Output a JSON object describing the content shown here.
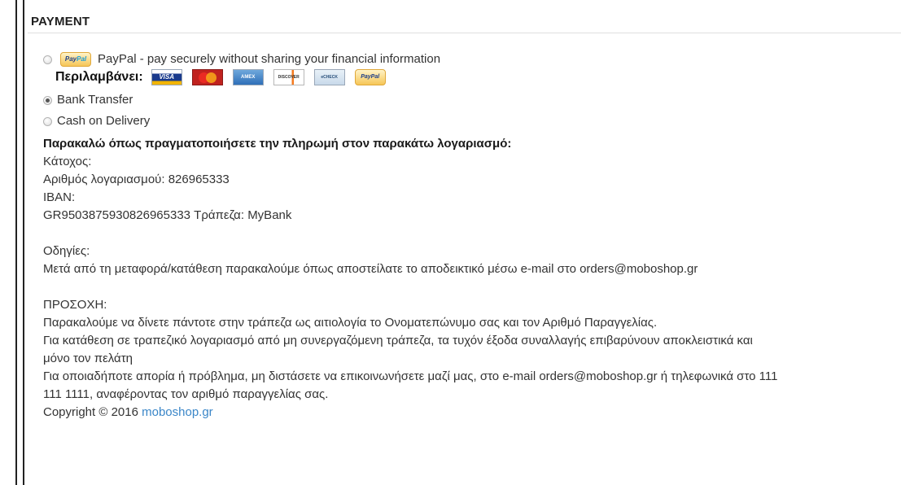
{
  "section": {
    "title": "PAYMENT"
  },
  "payment_methods": [
    {
      "label": "PayPal - pay securely without sharing your financial information",
      "selected": false,
      "logo_text": "PayPal"
    },
    {
      "label": "Bank Transfer",
      "selected": true
    },
    {
      "label": "Cash on Delivery",
      "selected": false
    }
  ],
  "cards": {
    "label": "Περιλαμβάνει:",
    "items": [
      {
        "name": "visa",
        "text": "VISA"
      },
      {
        "name": "mastercard",
        "text": ""
      },
      {
        "name": "amex",
        "text": "AMEX"
      },
      {
        "name": "discover",
        "text": "DISCOVER"
      },
      {
        "name": "echeck",
        "text": "eCHECK"
      },
      {
        "name": "paypal",
        "text": "PayPal"
      }
    ]
  },
  "bank_details": {
    "heading": "Παρακαλώ όπως πραγματοποιήσετε την πληρωμή στον παρακάτω λογαριασμό:",
    "holder": "Κάτοχος:",
    "account": "Αριθμός λογαριασμού: 826965333",
    "iban_label": "IBAN:",
    "iban_bank": "GR9503875930826965333 Τράπεζα: MyBank"
  },
  "instructions": {
    "label": "Οδηγίες:",
    "text": "Μετά από τη μεταφορά/κατάθεση παρακαλούμε όπως αποστείλατε το αποδεικτικό μέσω e-mail στο orders@moboshop.gr"
  },
  "notice": {
    "label": "ΠΡΟΣΟΧΗ:",
    "line1": "Παρακαλούμε να δίνετε πάντοτε στην τράπεζα ως αιτιολογία το Ονοματεπώνυμο σας και τον Αριθμό Παραγγελίας.",
    "line2a": "Για κατάθεση σε τραπεζικό λογαριασμό από μη συνεργαζόμενη τράπεζα, τα τυχόν έξοδα συναλλαγής επιβαρύνουν αποκλειστικά και",
    "line2b": "μόνο τον πελάτη",
    "line3a": "Για οποιαδήποτε απορία ή πρόβλημα, μη διστάσετε να επικοινωνήσετε μαζί μας, στο e-mail orders@moboshop.gr ή τηλεφωνικά στο 111",
    "line3b": "111 1111, αναφέροντας τον αριθμό παραγγελίας σας."
  },
  "footer": {
    "copyright": "Copyright © 2016",
    "link": "moboshop.gr"
  }
}
